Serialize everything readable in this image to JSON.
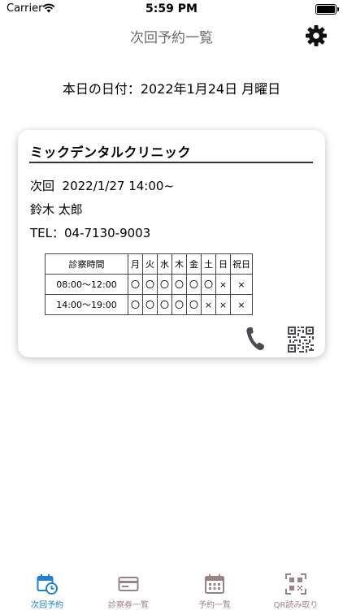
{
  "status_bar": {
    "carrier": "Carrier",
    "time": "5:59 PM"
  },
  "nav": {
    "title": "次回予約一覧"
  },
  "today": {
    "text": "本日の日付：2022年1月24日 月曜日"
  },
  "card": {
    "clinic_name": "ミックデンタルクリニック",
    "next_appointment": "次回  2022/1/27 14:00~",
    "patient_name": "鈴木 太郎",
    "tel": "TEL：04-7130-9003",
    "hours": {
      "header": [
        "診察時間",
        "月",
        "火",
        "水",
        "木",
        "金",
        "土",
        "日",
        "祝日"
      ],
      "rows": [
        [
          "08:00～12:00",
          "〇",
          "〇",
          "〇",
          "〇",
          "〇",
          "〇",
          "×",
          "×"
        ],
        [
          "14:00～19:00",
          "〇",
          "〇",
          "〇",
          "〇",
          "〇",
          "×",
          "×",
          "×"
        ]
      ]
    }
  },
  "tabs": [
    {
      "label": "次回予約",
      "icon": "calendar-clock-icon",
      "active": true
    },
    {
      "label": "診察券一覧",
      "icon": "card-icon",
      "active": false
    },
    {
      "label": "予約一覧",
      "icon": "calendar-icon",
      "active": false
    },
    {
      "label": "QR読み取り",
      "icon": "qr-scan-icon",
      "active": false
    }
  ],
  "colors": {
    "accent": "#1a7fe0",
    "inactive_tab": "#9b8286",
    "title_gray": "#6b6b6b",
    "icon_dark": "#4a4a55"
  }
}
